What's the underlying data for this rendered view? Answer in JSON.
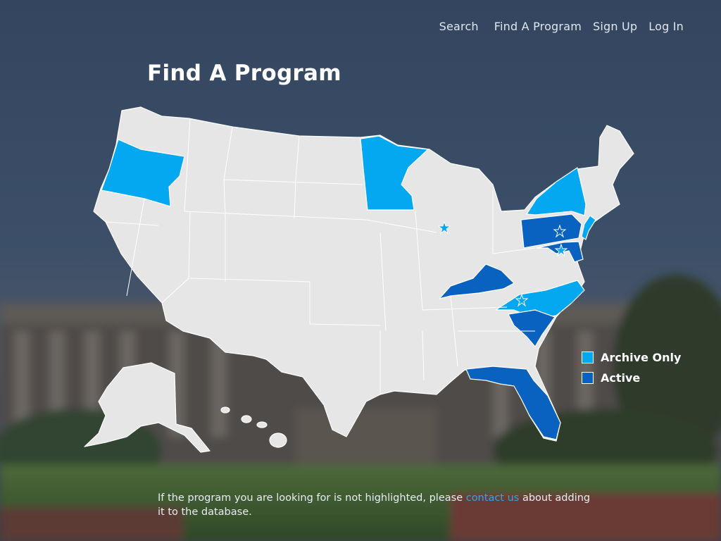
{
  "nav": {
    "items": [
      "Search",
      "Find A Program",
      "Sign Up",
      "Log In"
    ]
  },
  "page": {
    "title": "Find A Program"
  },
  "legend": {
    "items": [
      {
        "label": "Archive Only",
        "color": "#04a8f0"
      },
      {
        "label": "Active",
        "color": "#0a62c0"
      }
    ]
  },
  "map": {
    "default_state_color": "#e6e6e6",
    "border_color": "#ffffff",
    "states": {
      "oregon": "archive",
      "minnesota": "archive",
      "new-york": "archive",
      "north-carolina": "archive",
      "new-jersey": "archive",
      "pennsylvania": "active",
      "kentucky": "active",
      "south-carolina": "active",
      "florida": "active",
      "maryland": "active"
    },
    "markers": [
      "illinois-star",
      "pennsylvania-star",
      "maryland-star",
      "north-carolina-star"
    ]
  },
  "footer": {
    "text_before": "If the program you are looking for is not highlighted, please ",
    "link": "contact us",
    "text_after": " about adding it to the database."
  },
  "colors": {
    "archive": "#04a8f0",
    "active": "#0a62c0",
    "link": "#28a8ef"
  }
}
